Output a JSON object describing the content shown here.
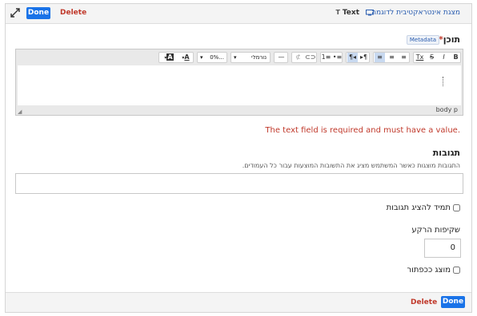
{
  "header": {
    "done_label": "Done",
    "delete_label": "Delete",
    "type_icon": "T",
    "type_label": "Text",
    "title": "מצגת אינטראקטיבית לדוגמה"
  },
  "content_field": {
    "label": "תוכן",
    "required_mark": "*",
    "metadata_label": "Metadata"
  },
  "toolbar": {
    "bold": "B",
    "italic": "I",
    "strike": "S",
    "clear_format": "Tx",
    "align_left": "≡",
    "align_center": "≡",
    "align_right": "≡",
    "rtl": "¶◂",
    "ltr": "▸¶",
    "list_ol": "1≡",
    "list_ul": "•≡",
    "link": "⊂⊃",
    "unlink": "⊄",
    "hr": "—",
    "format_select": "נורמלי",
    "size_select": "0%...",
    "font_color": "A",
    "bg_color": "A"
  },
  "editor_footer": {
    "path": "body  p"
  },
  "error_text": "The text field is required and must have a value.",
  "answers": {
    "label": "תגובות",
    "help": "התגובות מוצגות כאשר המשתמש מציג את התשובות המוצעות עבור כל העמודים."
  },
  "always_show": {
    "label": "תמיד להציג תגובות"
  },
  "bg_transparency": {
    "label": "שקיפות הרקע",
    "value": "0"
  },
  "show_as_button": {
    "label": "מוצג ככפתור"
  },
  "footer": {
    "delete_label": "Delete",
    "done_label": "Done"
  },
  "colors": {
    "primary": "#1a73e8",
    "danger": "#c0392b",
    "link": "#2a5db0"
  }
}
